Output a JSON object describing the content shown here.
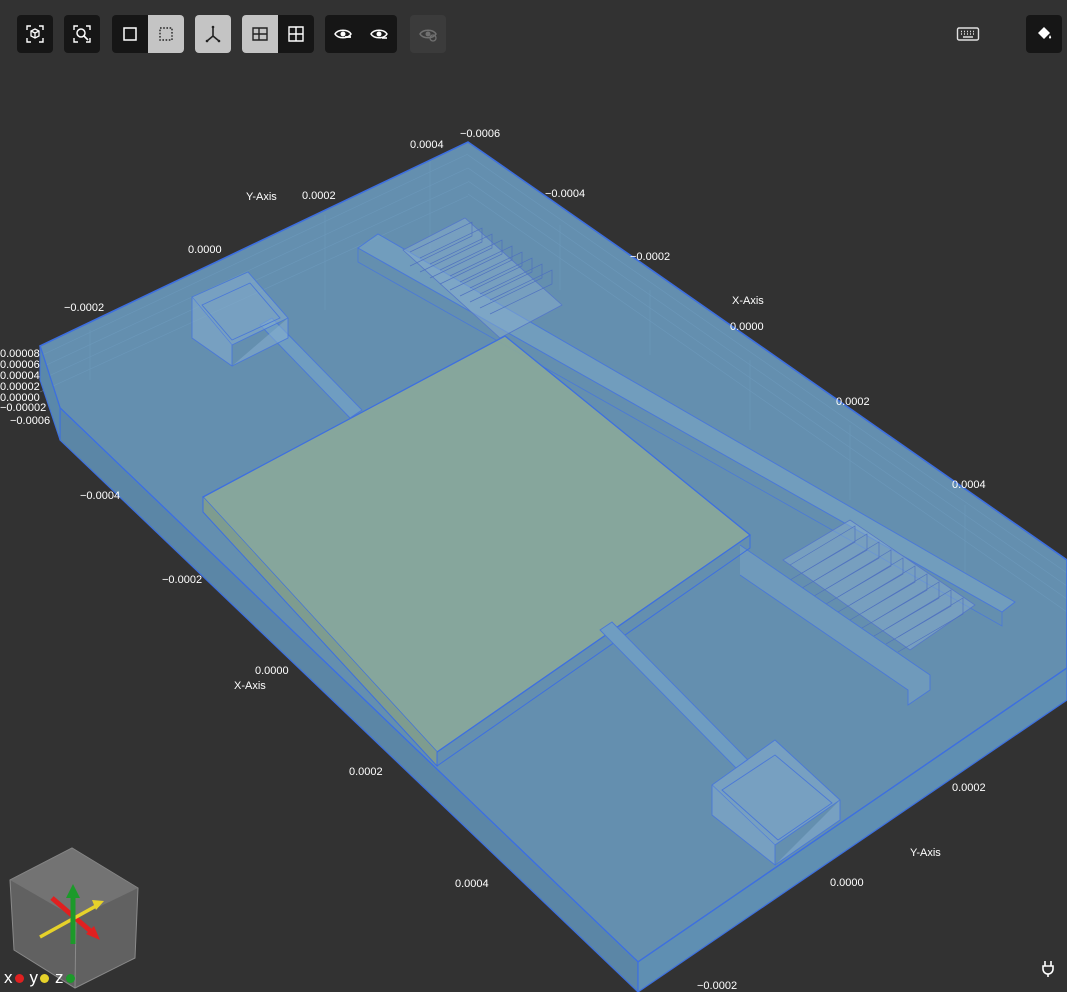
{
  "toolbar": {
    "buttons": [
      {
        "id": "fit-all",
        "icon": "cube-focus-icon",
        "state": "normal"
      },
      {
        "id": "zoom-fit",
        "icon": "zoom-search-icon",
        "state": "normal"
      },
      {
        "id": "select-single",
        "icon": "square-icon",
        "state": "normal"
      },
      {
        "id": "select-box",
        "icon": "dashed-square-icon",
        "state": "active"
      },
      {
        "id": "axes-toggle",
        "icon": "axes-icon",
        "state": "active"
      },
      {
        "id": "perspective",
        "icon": "perspective-icon",
        "state": "active"
      },
      {
        "id": "grid-view",
        "icon": "grid-icon",
        "state": "normal"
      },
      {
        "id": "show",
        "icon": "eye-show-icon",
        "state": "normal"
      },
      {
        "id": "show-all",
        "icon": "eye-plus-icon",
        "state": "normal"
      },
      {
        "id": "hide",
        "icon": "eye-hide-icon",
        "state": "disabled"
      },
      {
        "id": "keyboard",
        "icon": "keyboard-icon",
        "state": "normal"
      },
      {
        "id": "paint",
        "icon": "paint-bucket-icon",
        "state": "normal"
      }
    ]
  },
  "axes": {
    "x_axis_label": "X-Axis",
    "y_axis_label": "Y-Axis",
    "top_x_ticks": [
      "−0.0004",
      "−0.0002",
      "0.0000",
      "0.0002",
      "0.0004"
    ],
    "top_x_start": "−0.0006",
    "top_y_ticks": [
      "0.0004",
      "0.0002",
      "0.0000",
      "−0.0002"
    ],
    "bottom_x_ticks": [
      "−0.0004",
      "−0.0002",
      "0.0000",
      "0.0002",
      "0.0004"
    ],
    "bottom_y_ticks": [
      "0.0002",
      "0.0000",
      "−0.0002"
    ],
    "z_ticks": [
      "0.00008",
      "0.00006",
      "0.00004",
      "0.00002",
      "0.00000",
      "−0.00002"
    ],
    "z_corner": "−0.0006"
  },
  "triad": {
    "x": "x",
    "y": "y",
    "z": "z",
    "colors": {
      "x": "#e02020",
      "y": "#e6d22a",
      "z": "#1c9a2a"
    }
  },
  "scene_colors": {
    "body": "#6b9cc0",
    "chamber": "#8aa99a",
    "edge": "#3d6fe0"
  }
}
